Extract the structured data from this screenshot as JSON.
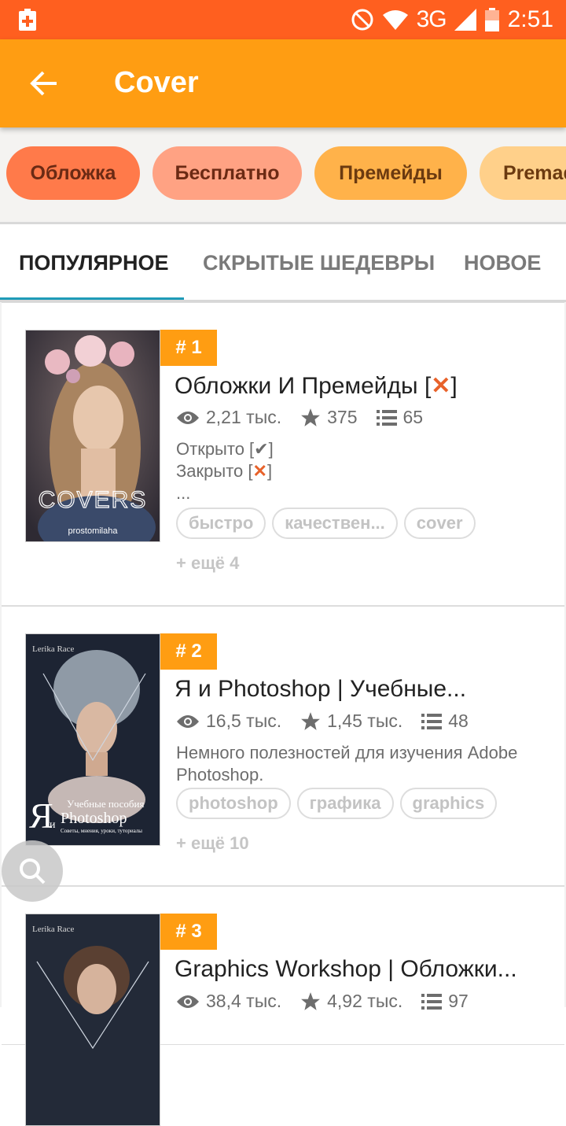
{
  "status_bar": {
    "network": "3G",
    "time": "2:51"
  },
  "app_bar": {
    "title": "Cover"
  },
  "chips": [
    {
      "label": "Обложка",
      "bg": "#ff7a4a",
      "color": "#6b2a14"
    },
    {
      "label": "Бесплатно",
      "bg": "#ffa283",
      "color": "#6b2a14"
    },
    {
      "label": "Премейды",
      "bg": "#ffb24a",
      "color": "#6b3a10"
    },
    {
      "label": "Premades",
      "bg": "#ffd08a",
      "color": "#6b3a10"
    }
  ],
  "tabs": [
    {
      "label": "ПОПУЛЯРНОЕ",
      "active": true
    },
    {
      "label": "СКРЫТЫЕ ШЕДЕВРЫ",
      "active": false
    },
    {
      "label": "НОВОЕ",
      "active": false
    }
  ],
  "stories": [
    {
      "rank": "# 1",
      "title": "Обложки И Премейды [",
      "title_suffix": "]",
      "views": "2,21 тыс.",
      "votes": "375",
      "parts": "65",
      "desc_line1": "Открыто [✔]",
      "desc_line2_prefix": "Закрыто [",
      "desc_line2_suffix": "]",
      "desc_line3": "...",
      "tags": [
        "быстро",
        "качествен...",
        "cover"
      ],
      "more": "+ ещё 4",
      "cover_text": "COVERS",
      "cover_sub": "prostomilaha"
    },
    {
      "rank": "# 2",
      "title": "Я и Photoshop | Учебные...",
      "views": "16,5 тыс.",
      "votes": "1,45 тыс.",
      "parts": "48",
      "desc": "Немного полезностей для изучения Adobe Photoshop.",
      "tags": [
        "photoshop",
        "графика",
        "graphics"
      ],
      "more": "+ ещё 10",
      "cover_author": "Lerika Race",
      "cover_big": "Я",
      "cover_small": "и",
      "cover_line1": "Учебные пособия",
      "cover_line2": "Photoshop",
      "cover_line3": "Советы, мнения, уроки, туториалы"
    },
    {
      "rank": "# 3",
      "title": "Graphics Workshop | Обложки...",
      "views": "38,4 тыс.",
      "votes": "4,92 тыс.",
      "parts": "97",
      "cover_author": "Lerika Race"
    }
  ]
}
